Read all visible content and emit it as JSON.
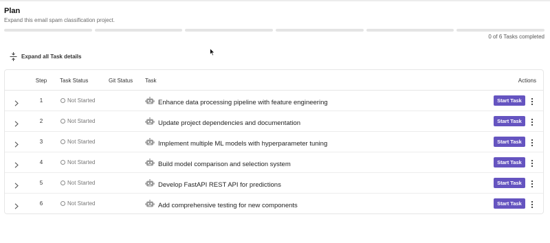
{
  "header": {
    "title": "Plan",
    "subtitle": "Expand this email spam classification project."
  },
  "progress": {
    "completed": 0,
    "total": 6,
    "label": "0 of 6 Tasks completed",
    "accent_color": "#6554c0"
  },
  "toolbar": {
    "expand_all_label": "Expand all Task details"
  },
  "table": {
    "columns": {
      "step": "Step",
      "task_status": "Task Status",
      "git_status": "Git Status",
      "task": "Task",
      "actions": "Actions"
    },
    "rows": [
      {
        "step": "1",
        "status": "Not Started",
        "git_status": "",
        "task": "Enhance data processing pipeline with feature engineering",
        "action": "Start Task"
      },
      {
        "step": "2",
        "status": "Not Started",
        "git_status": "",
        "task": "Update project dependencies and documentation",
        "action": "Start Task"
      },
      {
        "step": "3",
        "status": "Not Started",
        "git_status": "",
        "task": "Implement multiple ML models with hyperparameter tuning",
        "action": "Start Task"
      },
      {
        "step": "4",
        "status": "Not Started",
        "git_status": "",
        "task": "Build model comparison and selection system",
        "action": "Start Task"
      },
      {
        "step": "5",
        "status": "Not Started",
        "git_status": "",
        "task": "Develop FastAPI REST API for predictions",
        "action": "Start Task"
      },
      {
        "step": "6",
        "status": "Not Started",
        "git_status": "",
        "task": "Add comprehensive testing for new components",
        "action": "Start Task"
      }
    ]
  },
  "icons": {
    "expand_all": "expand-vertical-icon",
    "row_expand": "chevron-right-icon",
    "status": "circle-outline-icon",
    "task": "robot-icon",
    "more": "more-vertical-icon",
    "cursor": "mouse-pointer-icon"
  }
}
